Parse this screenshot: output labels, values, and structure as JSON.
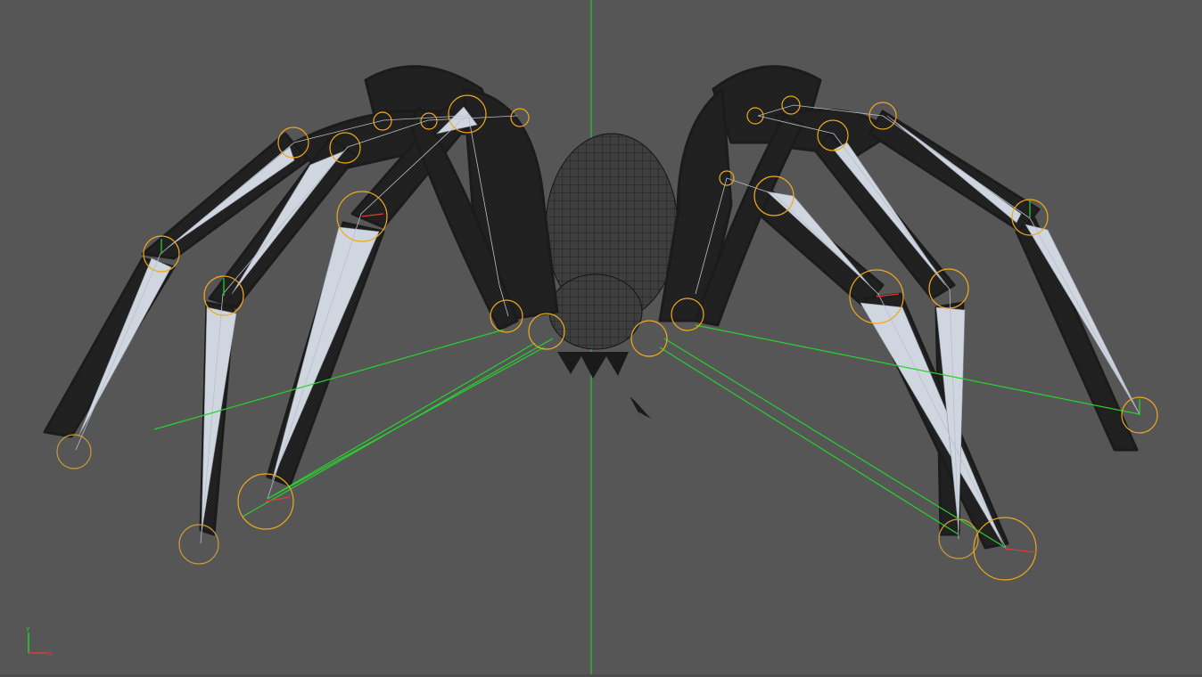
{
  "viewport": {
    "name": "3D viewport",
    "background": "#565656",
    "mesh_color": "#1e1e1e",
    "bone_color": "#cfd6e0",
    "ik_line_color": "#29d12e",
    "joint_color": "#f0a81c",
    "y_axis_color": "#29d12e",
    "x_axis_color": "#e03a3a"
  },
  "axis_gizmo": {
    "y_label": "Y",
    "x_label": "X",
    "y_icon": "y-axis-arrow-icon",
    "x_icon": "x-axis-arrow-icon"
  },
  "scene": {
    "object": "spider-rig-icon"
  }
}
